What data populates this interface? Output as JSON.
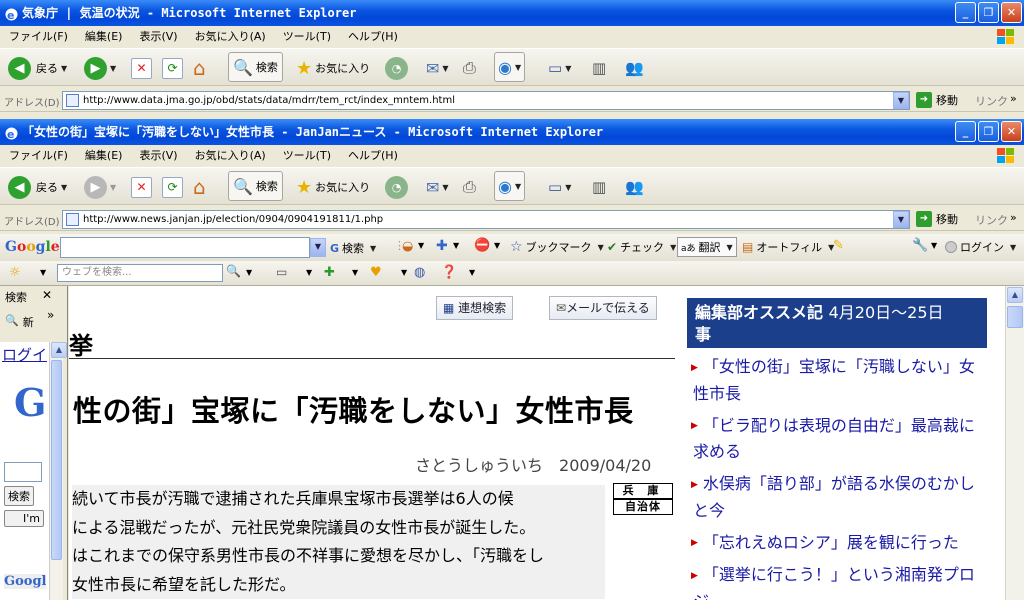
{
  "window1": {
    "title": "気象庁 | 気温の状況 - Microsoft Internet Explorer",
    "menus": [
      "ファイル(F)",
      "編集(E)",
      "表示(V)",
      "お気に入り(A)",
      "ツール(T)",
      "ヘルプ(H)"
    ],
    "back_label": "戻る",
    "search_label": "検索",
    "favorites_label": "お気に入り",
    "address_label": "アドレス(D)",
    "url": "http://www.data.jma.go.jp/obd/stats/data/mdrr/tem_rct/index_mntem.html",
    "go_label": "移動",
    "links_label": "リンク"
  },
  "window2": {
    "title": "「女性の街」宝塚に「汚職をしない」女性市長 - JanJanニュース - Microsoft Internet Explorer",
    "menus": [
      "ファイル(F)",
      "編集(E)",
      "表示(V)",
      "お気に入り(A)",
      "ツール(T)",
      "ヘルプ(H)"
    ],
    "back_label": "戻る",
    "search_label": "検索",
    "favorites_label": "お気に入り",
    "address_label": "アドレス(D)",
    "url": "http://www.news.janjan.jp/election/0904/0904191811/1.php",
    "go_label": "移動",
    "links_label": "リンク"
  },
  "google_toolbar": {
    "logo": "Google",
    "search_label": "検索",
    "bookmark_label": "ブックマーク",
    "check_label": "チェック",
    "translate_label": "翻訳",
    "autofill_label": "オートフィル",
    "login_label": "ログイン"
  },
  "search_bar": {
    "placeholder": "ウェブを検索..."
  },
  "sidebar": {
    "title": "検索",
    "close": "✕",
    "new_label": "新",
    "chevron": "»",
    "login_link": "ログイ",
    "logo_letter": "G",
    "search_button": "検索",
    "lucky_button": "I'm",
    "footer_logo": "Googl"
  },
  "article": {
    "related_search": "連想検索",
    "mail_button": "メールで伝える",
    "section": "挙",
    "headline": "性の街」宝塚に「汚職をしない」女性市長",
    "author": "さとうしゅういち",
    "date": "2009/04/20",
    "tag_line1": "兵 庫",
    "tag_line2": "自治体",
    "body": [
      "続いて市長が汚職で逮捕された兵庫県宝塚市長選挙は6人の候",
      "による混戦だったが、元社民党衆院議員の女性市長が誕生した。",
      "はこれまでの保守系男性市長の不祥事に愛想を尽かし、「汚職をし",
      "女性市長に希望を託した形だ。"
    ]
  },
  "editorial": {
    "title": "編集部オススメ記",
    "period": "4月20日〜25日",
    "suffix": "事",
    "items": [
      "「女性の街」宝塚に「汚職しない」女性市長",
      "「ビラ配りは表現の自由だ」最高裁に求める",
      "水俣病「語り部」が語る水俣のむかしと今",
      "「忘れえぬロシア」展を観に行った",
      "「選挙に行こう！」という湘南発プロジ"
    ]
  },
  "colors": {
    "title_blue": "#0a56e0",
    "editorial_bg": "#1c3f8c",
    "link_blue": "#1a1aa6",
    "bullet_red": "#cc0000"
  }
}
